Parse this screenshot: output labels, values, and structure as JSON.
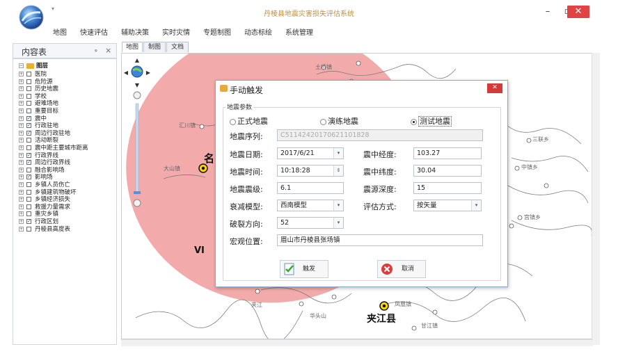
{
  "window": {
    "title": "丹棱县地震灾害损失评估系统",
    "minimize_glyph": "–",
    "maximize_glyph": "▫",
    "close_glyph": "✕",
    "quick_access_glyph": "▾"
  },
  "menu": [
    "地图",
    "快速评估",
    "辅助决策",
    "实时灾情",
    "专题制图",
    "动态标绘",
    "系统管理"
  ],
  "toc": {
    "title": "内容表",
    "pin_glyph": "ᵩ",
    "close_glyph": "×",
    "root_label": "图层",
    "root_expander": "−",
    "layers": [
      {
        "label": "医院",
        "checked": false
      },
      {
        "label": "危险源",
        "checked": false
      },
      {
        "label": "历史地震",
        "checked": false
      },
      {
        "label": "学校",
        "checked": false
      },
      {
        "label": "避难场地",
        "checked": false
      },
      {
        "label": "重要目标",
        "checked": false
      },
      {
        "label": "震中",
        "checked": true
      },
      {
        "label": "行政驻地",
        "checked": true
      },
      {
        "label": "周边行政驻地",
        "checked": true
      },
      {
        "label": "活动断裂",
        "checked": false
      },
      {
        "label": "震中距主要城市距离",
        "checked": false
      },
      {
        "label": "行政界线",
        "checked": true
      },
      {
        "label": "周边行政界线",
        "checked": true
      },
      {
        "label": "融合影响场",
        "checked": false
      },
      {
        "label": "影响场",
        "checked": true
      },
      {
        "label": "乡镇人员伤亡",
        "checked": false
      },
      {
        "label": "乡镇建筑物破坏",
        "checked": false
      },
      {
        "label": "乡镇经济损失",
        "checked": false
      },
      {
        "label": "救援力量需求",
        "checked": false
      },
      {
        "label": "重灾乡镇",
        "checked": false
      },
      {
        "label": "行政区划",
        "checked": true
      },
      {
        "label": "丹棱县高度表",
        "checked": false
      }
    ]
  },
  "tabs": [
    "地图",
    "制图",
    "文档"
  ],
  "map": {
    "intensity_color": "#f2a1a2",
    "labels": {
      "partial_name": "名",
      "intensity_vi": "VI",
      "county": "夹江县",
      "town_ganjiang": "甘江镇",
      "town_fenghuang": "凤凰镇",
      "label_jiajiang_short": "夹江",
      "label_huabaoshan": "华头山",
      "label_tuqiao": "土桥镇",
      "label_sanlian": "三联乡",
      "label_zhongxiang": "中镇乡",
      "label_gongjing": "宫镇乡",
      "label_dashan": "大山镇",
      "label_huichuan": "汇川镇"
    }
  },
  "dialog": {
    "title": "手动触发",
    "close_glyph": "✕",
    "group_title": "地震参数",
    "radios": [
      {
        "label": "正式地震",
        "selected": false
      },
      {
        "label": "演练地震",
        "selected": false
      },
      {
        "label": "测试地震",
        "selected": true
      }
    ],
    "serial": {
      "label": "地震序列:",
      "value": "C51142420170621101828"
    },
    "date": {
      "label": "地震日期:",
      "value": "2017/6/21"
    },
    "time": {
      "label": "地震时间:",
      "value": "10:18:28"
    },
    "magnitude": {
      "label": "地震震级:",
      "value": "6.1"
    },
    "attenuation": {
      "label": "衰减模型:",
      "value": "西南模型"
    },
    "rupture": {
      "label": "破裂方向:",
      "value": "52"
    },
    "location": {
      "label": "宏观位置:",
      "value": "眉山市丹棱县张场镇"
    },
    "longitude": {
      "label": "震中经度:",
      "value": "103.27"
    },
    "latitude": {
      "label": "震中纬度:",
      "value": "30.04"
    },
    "depth": {
      "label": "震源深度:",
      "value": "15"
    },
    "method": {
      "label": "评估方式:",
      "value": "按矢量"
    },
    "trigger_label": "触发",
    "cancel_label": "取消",
    "dropdown_glyph": "▾",
    "spinner_glyph": "⇕"
  }
}
